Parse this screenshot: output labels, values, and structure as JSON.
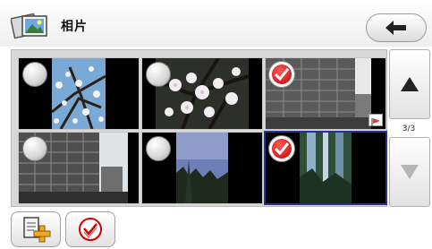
{
  "header": {
    "title": "相片",
    "app_icon": "photo-album-icon",
    "back_icon": "left-arrow-icon"
  },
  "grid": {
    "thumbnails": [
      {
        "subject": "blossom-branches",
        "selected": false
      },
      {
        "subject": "white-blossoms",
        "selected": false
      },
      {
        "subject": "building",
        "selected": true
      },
      {
        "subject": "building",
        "selected": false
      },
      {
        "subject": "trees-sky",
        "selected": false
      },
      {
        "subject": "forest-light",
        "selected": true
      }
    ]
  },
  "pager": {
    "indicator": "3/3",
    "up_icon": "up-triangle-icon",
    "down_icon": "down-triangle-icon",
    "down_enabled": false
  },
  "toolbar": {
    "add_icon": "add-document-icon",
    "select_all_icon": "select-all-check-icon"
  },
  "colors": {
    "selection_border": "#2c2e9a",
    "check_red": "#d40000"
  }
}
